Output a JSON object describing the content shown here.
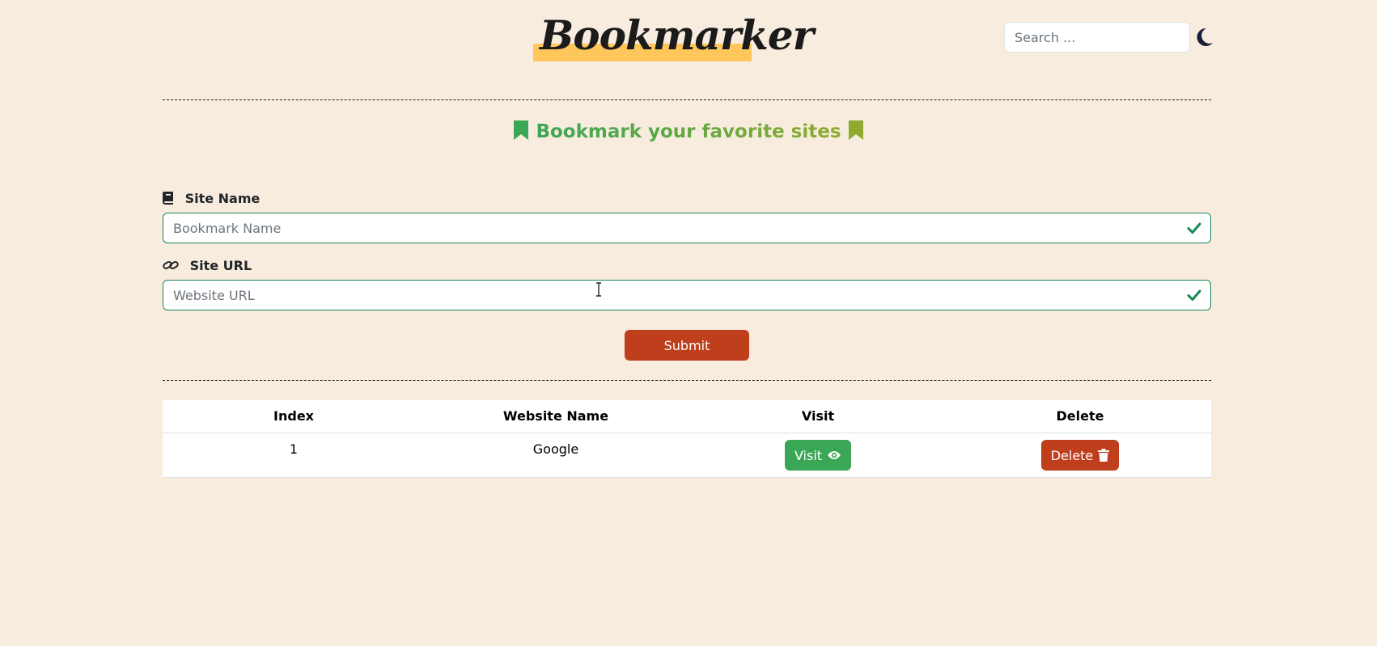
{
  "header": {
    "brand_text": "Bookmarker",
    "search": {
      "placeholder": "Search ...",
      "value": ""
    },
    "theme_toggle_icon": "moon-icon"
  },
  "subtitle": {
    "text": "Bookmark your favorite sites",
    "left_icon": "bookmark-icon",
    "right_icon": "bookmark-icon",
    "colors": {
      "start": "#3aa757",
      "end": "#8faa2e"
    }
  },
  "form": {
    "site_name": {
      "label": "Site Name",
      "icon": "book-icon",
      "placeholder": "Bookmark Name",
      "value": "",
      "valid": true
    },
    "site_url": {
      "label": "Site URL",
      "icon": "link-icon",
      "placeholder": "Website URL",
      "value": "",
      "valid": true
    },
    "submit_label": "Submit"
  },
  "table": {
    "headers": [
      "Index",
      "Website Name",
      "Visit",
      "Delete"
    ],
    "rows": [
      {
        "index": "1",
        "name": "Google",
        "visit_label": "Visit",
        "visit_icon": "eye-icon",
        "delete_label": "Delete",
        "delete_icon": "trash-icon"
      }
    ]
  },
  "colors": {
    "background": "#f8ecdf",
    "accent_red": "#bf3e1c",
    "accent_green": "#3aa757",
    "valid_border": "#198754",
    "brand_highlight": "#ffc65c"
  }
}
